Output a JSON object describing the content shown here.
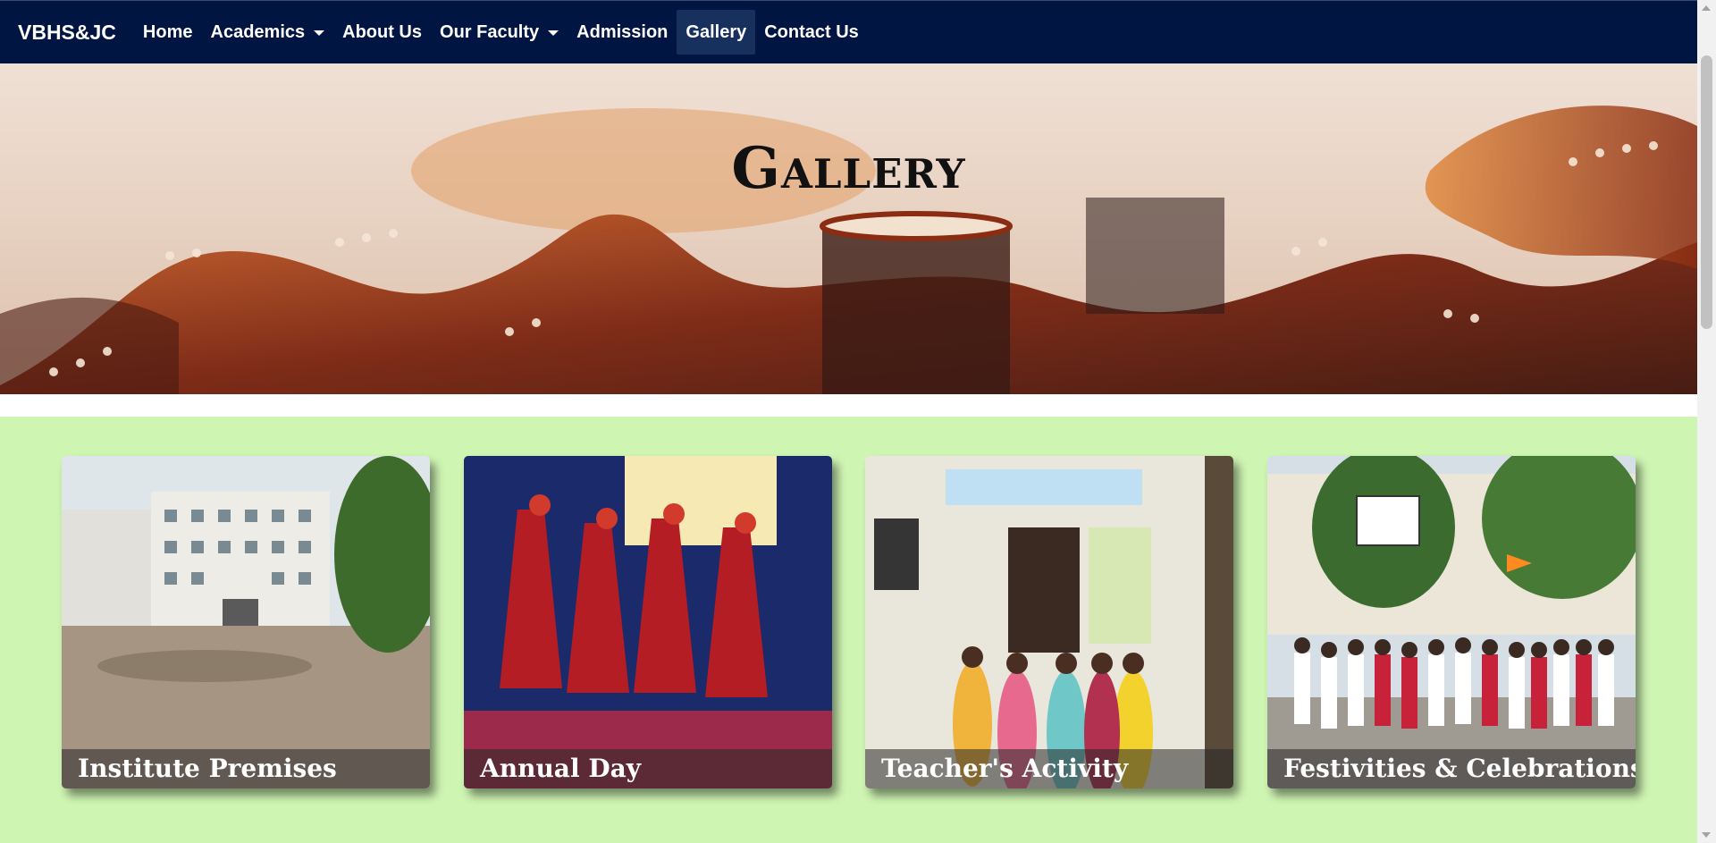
{
  "navbar": {
    "brand": "VBHS&JC",
    "items": [
      {
        "label": "Home"
      },
      {
        "label": "Academics"
      },
      {
        "label": "About Us"
      },
      {
        "label": "Our Faculty"
      },
      {
        "label": "Admission"
      },
      {
        "label": "Gallery"
      },
      {
        "label": "Contact Us"
      }
    ],
    "active": "Gallery",
    "bg_color": "#001541"
  },
  "hero": {
    "title": "Gallery",
    "image": "film-reel-banner"
  },
  "gallery": {
    "bg_color": "#cff5b3",
    "cards": [
      {
        "caption": "Institute Premises",
        "image": "school-building-photo"
      },
      {
        "caption": "Annual Day",
        "image": "dance-performance-photo"
      },
      {
        "caption": "Teacher's Activity",
        "image": "teachers-group-photo"
      },
      {
        "caption": "Festivities & Celebrations",
        "image": "celebration-group-photo"
      }
    ]
  }
}
